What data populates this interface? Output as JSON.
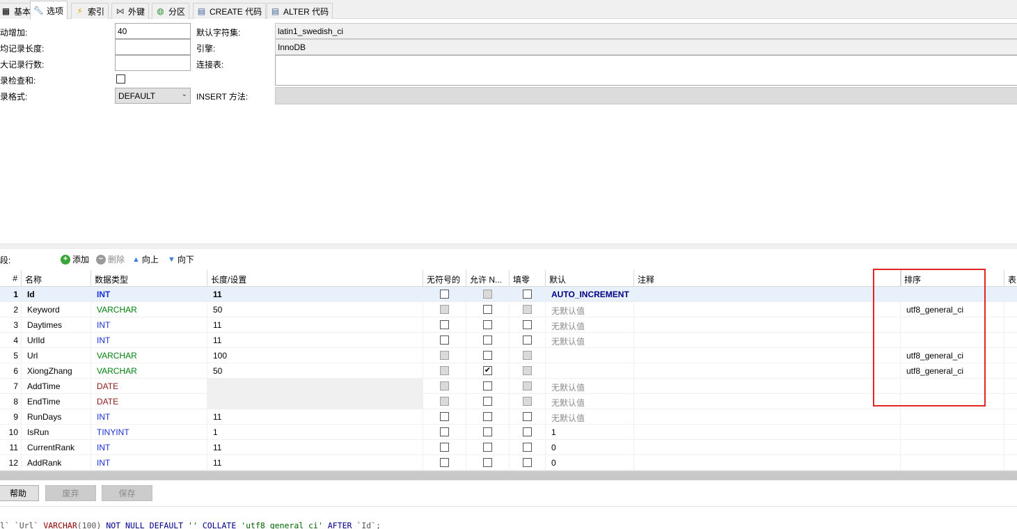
{
  "tabs": [
    {
      "label": "基本",
      "icon": "table-icon"
    },
    {
      "label": "选项",
      "icon": "wrench-icon",
      "active": true
    },
    {
      "label": "索引",
      "icon": "lightning-icon"
    },
    {
      "label": "外键",
      "icon": "foreign-key-icon"
    },
    {
      "label": "分区",
      "icon": "globe-icon"
    },
    {
      "label": "CREATE 代码",
      "icon": "code-icon"
    },
    {
      "label": "ALTER 代码",
      "icon": "code-icon"
    }
  ],
  "options": {
    "auto_inc_label": "自动增加:",
    "auto_inc_value": "40",
    "avg_len_label": "平均记录长度:",
    "avg_len_value": "",
    "max_rows_label": "最大记录行数:",
    "max_rows_value": "",
    "checksum_label": "记录检查和:",
    "row_format_label": "记录格式:",
    "row_format_value": "DEFAULT",
    "charset_label": "默认字符集:",
    "charset_value": "latin1_swedish_ci",
    "engine_label": "引擎:",
    "engine_value": "InnoDB",
    "union_label": "连接表:",
    "union_value": "",
    "insert_method_label": "INSERT 方法:",
    "insert_method_value": ""
  },
  "toolbar": {
    "fields_label": "字段:",
    "add_label": "添加",
    "delete_label": "删除",
    "up_label": "向上",
    "down_label": "向下"
  },
  "grid": {
    "headers": [
      "#",
      "名称",
      "数据类型",
      "长度/设置",
      "无符号的",
      "允许 N...",
      "填零",
      "默认",
      "注释",
      "",
      "排序",
      "表"
    ],
    "rows": [
      {
        "n": "1",
        "name": "Id",
        "type": "INT",
        "length": "11",
        "unsigned": false,
        "allow_null": false,
        "zerofill": false,
        "default": "AUTO_INCREMENT",
        "comment": "",
        "collation": ""
      },
      {
        "n": "2",
        "name": "Keyword",
        "type": "VARCHAR",
        "length": "50",
        "unsigned": false,
        "allow_null": false,
        "zerofill": false,
        "default": "无默认值",
        "comment": "",
        "collation": "utf8_general_ci"
      },
      {
        "n": "3",
        "name": "Daytimes",
        "type": "INT",
        "length": "11",
        "unsigned": false,
        "allow_null": false,
        "zerofill": false,
        "default": "无默认值",
        "comment": "",
        "collation": ""
      },
      {
        "n": "4",
        "name": "UrlId",
        "type": "INT",
        "length": "11",
        "unsigned": false,
        "allow_null": false,
        "zerofill": false,
        "default": "无默认值",
        "comment": "",
        "collation": ""
      },
      {
        "n": "5",
        "name": "Url",
        "type": "VARCHAR",
        "length": "100",
        "unsigned": false,
        "allow_null": false,
        "zerofill": false,
        "default": "",
        "comment": "",
        "collation": "utf8_general_ci"
      },
      {
        "n": "6",
        "name": "XiongZhang",
        "type": "VARCHAR",
        "length": "50",
        "unsigned": false,
        "allow_null": true,
        "zerofill": false,
        "default": "",
        "comment": "",
        "collation": "utf8_general_ci"
      },
      {
        "n": "7",
        "name": "AddTime",
        "type": "DATE",
        "length": "",
        "unsigned": false,
        "allow_null": false,
        "zerofill": false,
        "default": "无默认值",
        "comment": "",
        "collation": ""
      },
      {
        "n": "8",
        "name": "EndTime",
        "type": "DATE",
        "length": "",
        "unsigned": false,
        "allow_null": false,
        "zerofill": false,
        "default": "无默认值",
        "comment": "",
        "collation": ""
      },
      {
        "n": "9",
        "name": "RunDays",
        "type": "INT",
        "length": "11",
        "unsigned": false,
        "allow_null": false,
        "zerofill": false,
        "default": "无默认值",
        "comment": "",
        "collation": ""
      },
      {
        "n": "10",
        "name": "IsRun",
        "type": "TINYINT",
        "length": "1",
        "unsigned": false,
        "allow_null": false,
        "zerofill": false,
        "default": "1",
        "comment": "",
        "collation": ""
      },
      {
        "n": "11",
        "name": "CurrentRank",
        "type": "INT",
        "length": "11",
        "unsigned": false,
        "allow_null": false,
        "zerofill": false,
        "default": "0",
        "comment": "",
        "collation": ""
      },
      {
        "n": "12",
        "name": "AddRank",
        "type": "INT",
        "length": "11",
        "unsigned": false,
        "allow_null": false,
        "zerofill": false,
        "default": "0",
        "comment": "",
        "collation": ""
      }
    ]
  },
  "buttons": {
    "help": "帮助",
    "discard": "废弃",
    "save": "保存"
  },
  "sql": {
    "p1": "l` `Url` ",
    "p2": "VARCHAR",
    "p3": "(100) ",
    "p4": "NOT NULL DEFAULT",
    "p5": " '' ",
    "p6": "COLLATE",
    "p7": " 'utf8_general_ci' ",
    "p8": "AFTER",
    "p9": " `Id`;"
  },
  "colors": {
    "int": "#1a2fd6",
    "varchar": "#00800b",
    "date": "#8b1a1a",
    "highlight_box": "#e32222"
  }
}
